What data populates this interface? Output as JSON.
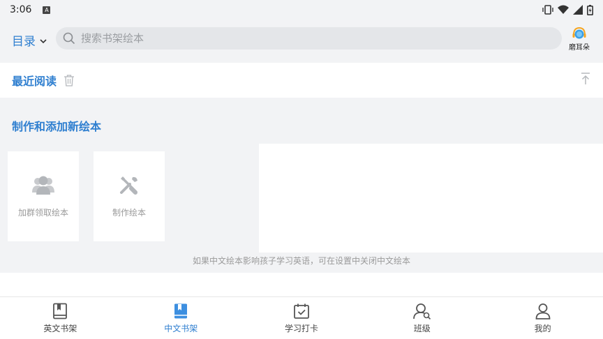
{
  "status_bar": {
    "time": "3:06",
    "notif_letter": "A"
  },
  "header": {
    "catalog_label": "目录",
    "search_placeholder": "搜索书架绘本",
    "moerduo_label": "磨耳朵"
  },
  "recent": {
    "title": "最近阅读"
  },
  "make": {
    "title": "制作和添加新绘本",
    "cards": [
      {
        "label": "加群领取绘本",
        "icon": "group-icon"
      },
      {
        "label": "制作绘本",
        "icon": "tools-icon"
      }
    ],
    "hint": "如果中文绘本影响孩子学习英语，可在设置中关闭中文绘本"
  },
  "tabs": [
    {
      "label": "英文书架",
      "icon": "book-icon",
      "active": false
    },
    {
      "label": "中文书架",
      "icon": "book-filled-icon",
      "active": true
    },
    {
      "label": "学习打卡",
      "icon": "calendar-check-icon",
      "active": false
    },
    {
      "label": "班级",
      "icon": "class-icon",
      "active": false
    },
    {
      "label": "我的",
      "icon": "person-icon",
      "active": false
    }
  ],
  "colors": {
    "accent": "#2f7fd0",
    "background": "#f2f3f5"
  }
}
